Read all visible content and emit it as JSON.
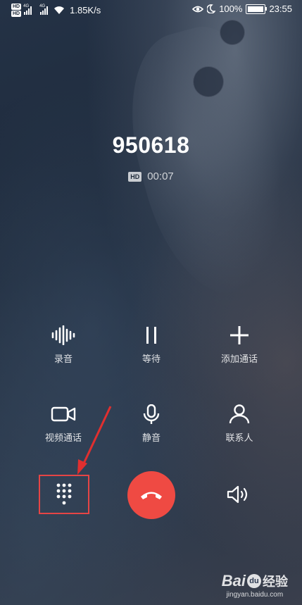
{
  "status_bar": {
    "hd_badges": [
      "HD",
      "HD"
    ],
    "sim1_network": "4G",
    "sim2_network": "4G",
    "speed": "1.85K/s",
    "battery": "100%",
    "time": "23:55",
    "icons": [
      "eye-icon",
      "moon-icon",
      "battery-icon",
      "wifi-icon",
      "signal-icon"
    ]
  },
  "call": {
    "number": "950618",
    "hd_label": "HD",
    "duration": "00:07"
  },
  "controls": {
    "record": {
      "label": "录音",
      "icon": "waveform-icon"
    },
    "hold": {
      "label": "等待",
      "icon": "pause-icon"
    },
    "add_call": {
      "label": "添加通话",
      "icon": "plus-icon"
    },
    "video_call": {
      "label": "视频通话",
      "icon": "video-camera-icon"
    },
    "mute": {
      "label": "静音",
      "icon": "microphone-icon"
    },
    "contacts": {
      "label": "联系人",
      "icon": "person-icon"
    }
  },
  "bottom_row": {
    "dialpad": {
      "icon": "dialpad-icon",
      "highlight_color": "#e64545"
    },
    "end_call": {
      "icon": "hangup-icon",
      "color": "#ef4a43"
    },
    "speaker": {
      "icon": "speaker-icon"
    }
  },
  "watermark": {
    "logo_text_left": "Bai",
    "logo_text_right": "经验",
    "url": "jingyan.baidu.com"
  }
}
